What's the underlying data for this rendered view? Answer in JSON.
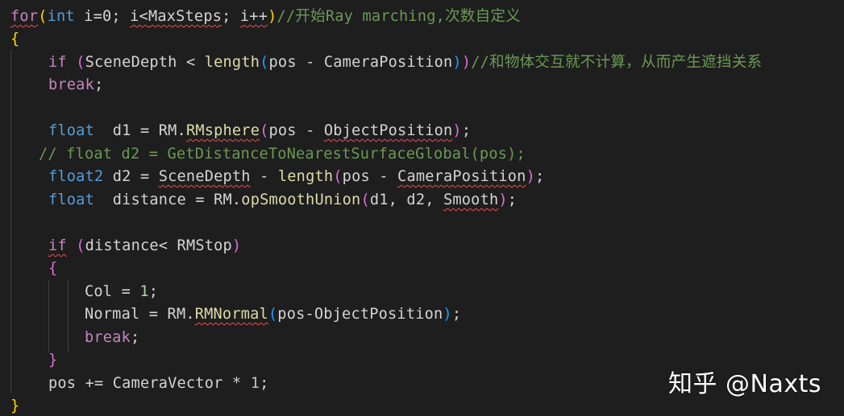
{
  "code": {
    "line1": {
      "for": "for",
      "open": "(",
      "int": "int",
      "init": " i=0; ",
      "i_lt": "i<",
      "maxsteps": "MaxSteps",
      "sep": "; ",
      "inc": "i++",
      "close": ")",
      "comment": "//开始Ray marching,次数自定义"
    },
    "line2": {
      "brace": "{"
    },
    "line3": {
      "if": "if",
      "open": "(",
      "cond1": "SceneDepth < ",
      "length": "length",
      "inner_open": "(",
      "args": "pos - CameraPosition",
      "inner_close": ")",
      "close": ")",
      "comment": "//和物体交互就不计算，从而产生遮挡关系"
    },
    "line4": {
      "break": "break",
      "semi": ";"
    },
    "line6": {
      "float": "float",
      "lhs": "  d1 = RM.",
      "fn": "RMsphere",
      "open": "(",
      "args_a": "pos - ",
      "args_b": "ObjectPosition",
      "close": ")",
      "semi": ";"
    },
    "line7": {
      "comment": "// float d2 = GetDistanceToNearestSurfaceGlobal(pos);"
    },
    "line8": {
      "float2": "float2",
      "lhs": " d2 = ",
      "scene": "SceneDepth",
      "minus": " - ",
      "length": "length",
      "open": "(",
      "args_a": "pos - ",
      "args_b": "CameraPosition",
      "close": ")",
      "semi": ";"
    },
    "line9": {
      "float": "float",
      "lhs": "  distance = RM.",
      "fn": "opSmoothUnion",
      "open": "(",
      "args_a": "d1, d2, ",
      "args_b": "Smooth",
      "close": ")",
      "semi": ";"
    },
    "line11": {
      "if": "if",
      "open": "(",
      "cond": "distance< RMStop",
      "close": ")"
    },
    "line12": {
      "brace": "{"
    },
    "line13": {
      "lhs": "Col = ",
      "num": "1",
      "semi": ";"
    },
    "line14": {
      "lhs": "Normal = RM.",
      "fn": "RMNormal",
      "open": "(",
      "args": "pos-ObjectPosition",
      "close": ")",
      "semi": ";"
    },
    "line15": {
      "break": "break",
      "semi": ";"
    },
    "line16": {
      "brace": "}"
    },
    "line17": {
      "lhs": "pos += CameraVector * ",
      "num": "1",
      "semi": ";"
    },
    "line18": {
      "brace": "}"
    }
  },
  "watermark": "知乎 @Naxts",
  "colors": {
    "background": "#1e1e1e",
    "keyword": "#569cd6",
    "control": "#c586c0",
    "function": "#dcdcaa",
    "comment": "#6a9955",
    "number": "#b5cea8",
    "type": "#4ec9b0",
    "bracket_gold": "#ffd700",
    "bracket_purple": "#da70d6",
    "bracket_blue": "#179fff",
    "error_squiggle": "#f14c4c"
  }
}
